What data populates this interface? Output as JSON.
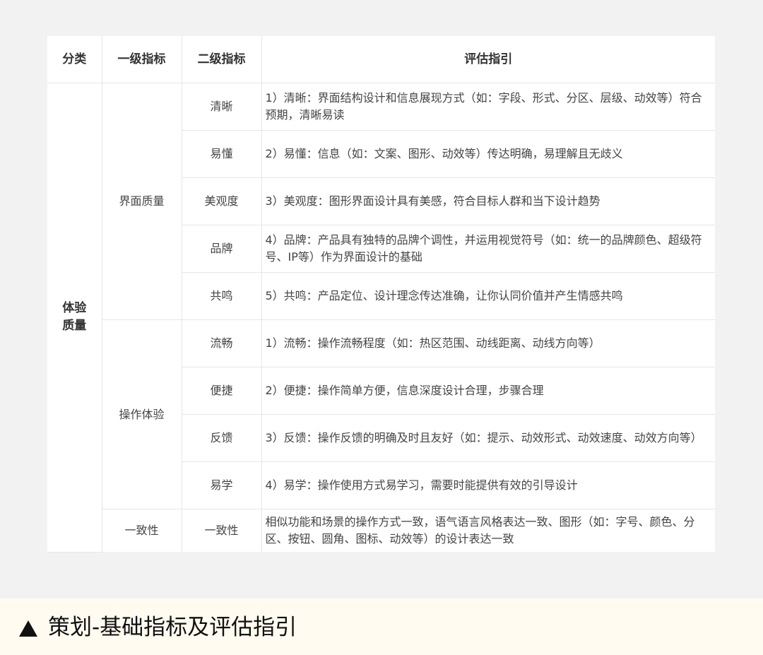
{
  "table": {
    "headers": [
      "分类",
      "一级指标",
      "二级指标",
      "评估指引"
    ],
    "category": {
      "line1": "体验",
      "line2": "质量"
    },
    "groups": [
      {
        "level1": "界面质量",
        "items": [
          {
            "level2": "清晰",
            "guide": "1）清晰：界面结构设计和信息展现方式（如：字段、形式、分区、层级、动效等）符合预期，清晰易读"
          },
          {
            "level2": "易懂",
            "guide": "2）易懂：信息（如：文案、图形、动效等）传达明确，易理解且无歧义"
          },
          {
            "level2": "美观度",
            "guide": "3）美观度：图形界面设计具有美感，符合目标人群和当下设计趋势"
          },
          {
            "level2": "品牌",
            "guide": "4）品牌：产品具有独特的品牌个调性，并运用视觉符号（如：统一的品牌颜色、超级符号、IP等）作为界面设计的基础"
          },
          {
            "level2": "共鸣",
            "guide": "5）共鸣：产品定位、设计理念传达准确，让你认同价值并产生情感共鸣"
          }
        ]
      },
      {
        "level1": "操作体验",
        "items": [
          {
            "level2": "流畅",
            "guide": "1）流畅：操作流畅程度（如：热区范围、动线距离、动线方向等）"
          },
          {
            "level2": "便捷",
            "guide": "2）便捷：操作简单方便，信息深度设计合理，步骤合理"
          },
          {
            "level2": "反馈",
            "guide": "3）反馈：操作反馈的明确及时且友好（如：提示、动效形式、动效速度、动效方向等）"
          },
          {
            "level2": "易学",
            "guide": "4）易学：操作使用方式易学习，需要时能提供有效的引导设计"
          }
        ]
      },
      {
        "level1": "一致性",
        "items": [
          {
            "level2": "一致性",
            "guide": "相似功能和场景的操作方式一致，语气语言风格表达一致、图形（如：字号、颜色、分区、按钮、圆角、图标、动效等）的设计表达一致"
          }
        ]
      }
    ]
  },
  "caption": {
    "icon": "triangle-up-icon",
    "text": "策划-基础指标及评估指引"
  }
}
